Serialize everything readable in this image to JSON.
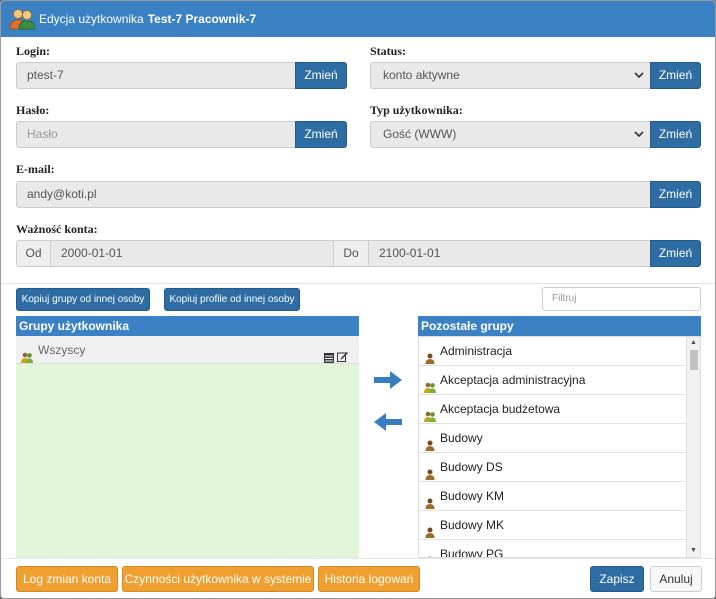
{
  "title": {
    "prefix": "Edycja użytkownika",
    "name": "Test-7 Pracownik-7"
  },
  "login": {
    "label": "Login:",
    "value": "ptest-7",
    "button": "Zmień"
  },
  "status": {
    "label": "Status:",
    "value": "konto aktywne",
    "button": "Zmień"
  },
  "password": {
    "label": "Hasło:",
    "placeholder": "Hasło",
    "button": "Zmień"
  },
  "user_type": {
    "label": "Typ użytkownika:",
    "value": "Gość (WWW)",
    "button": "Zmień"
  },
  "email": {
    "label": "E-mail:",
    "value": "andy@koti.pl",
    "button": "Zmień"
  },
  "validity": {
    "label": "Ważność konta:",
    "from_label": "Od",
    "from_value": "2000-01-01",
    "to_label": "Do",
    "to_value": "2100-01-01",
    "button": "Zmień"
  },
  "actions": {
    "copy_groups": "Kopiuj grupy od innej osoby",
    "copy_profiles": "Kopiuj profile od innej osoby",
    "filter_placeholder": "Filtruj"
  },
  "user_groups": {
    "header": "Grupy użytkownika",
    "items": [
      "Wszyscy"
    ]
  },
  "other_groups": {
    "header": "Pozostałe grupy",
    "items": [
      "Administracja",
      "Akceptacja administracyjna",
      "Akceptacja budżetowa",
      "Budowy",
      "Budowy DS",
      "Budowy KM",
      "Budowy MK",
      "Budowy PG"
    ]
  },
  "footer": {
    "log_changes": "Log zmian konta",
    "activities": "Czynności użytkownika w systemie",
    "login_history": "Historia logowań",
    "save": "Zapisz",
    "cancel": "Anuluj"
  },
  "colors": {
    "header_blue": "#3a82c4",
    "button_blue": "#2e6da4",
    "orange": "#f0a030",
    "green_panel": "#e1f5d8"
  },
  "icons": [
    "users-icon",
    "group-icon",
    "person-icon",
    "list-icon",
    "edit-icon",
    "arrow-right-icon",
    "arrow-left-icon",
    "chevron-down-icon"
  ]
}
